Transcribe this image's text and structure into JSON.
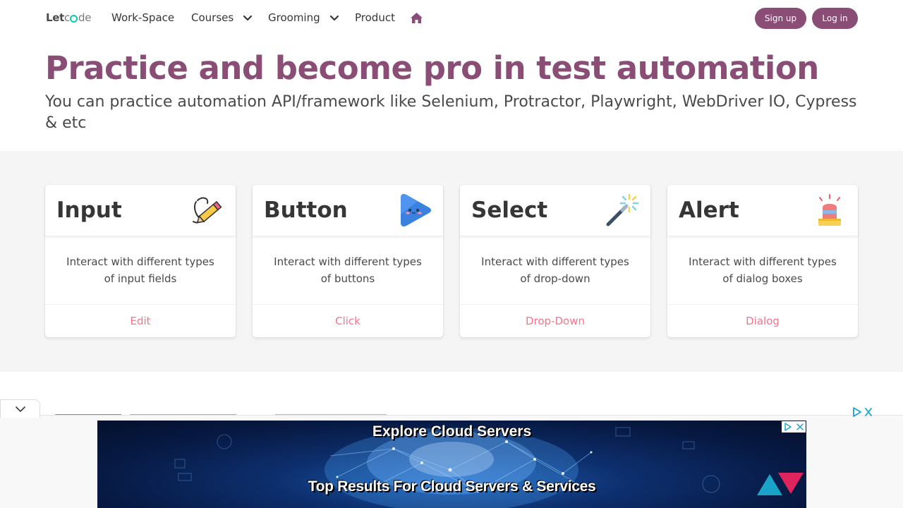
{
  "nav": {
    "logo_prefix": "Let",
    "logo_suffix": "de",
    "items": [
      {
        "label": "Work-Space"
      },
      {
        "label": "Courses"
      },
      {
        "label": "Grooming"
      },
      {
        "label": "Product"
      }
    ],
    "signup_label": "Sign up",
    "login_label": "Log in"
  },
  "hero": {
    "title": "Practice and become pro in test automation",
    "subtitle": "You can practice automation API/framework like Selenium, Protractor, Playwright, WebDriver IO, Cypress & etc"
  },
  "cards": [
    {
      "title": "Input",
      "description": "Interact with different types of input fields",
      "action": "Edit",
      "icon": "pencil-icon"
    },
    {
      "title": "Button",
      "description": "Interact with different types of buttons",
      "action": "Click",
      "icon": "play-button-icon"
    },
    {
      "title": "Select",
      "description": "Interact with different types of drop-down",
      "action": "Drop-Down",
      "icon": "magic-wand-icon"
    },
    {
      "title": "Alert",
      "description": "Interact with different types of dialog boxes",
      "action": "Dialog",
      "icon": "siren-icon"
    }
  ],
  "ad": {
    "headline": "Explore Cloud Servers",
    "subheadline": "Top Results For Cloud Servers & Services"
  },
  "colors": {
    "brand": "#8a4d76",
    "link": "#f14668",
    "section_bg": "#f5f5f5"
  }
}
